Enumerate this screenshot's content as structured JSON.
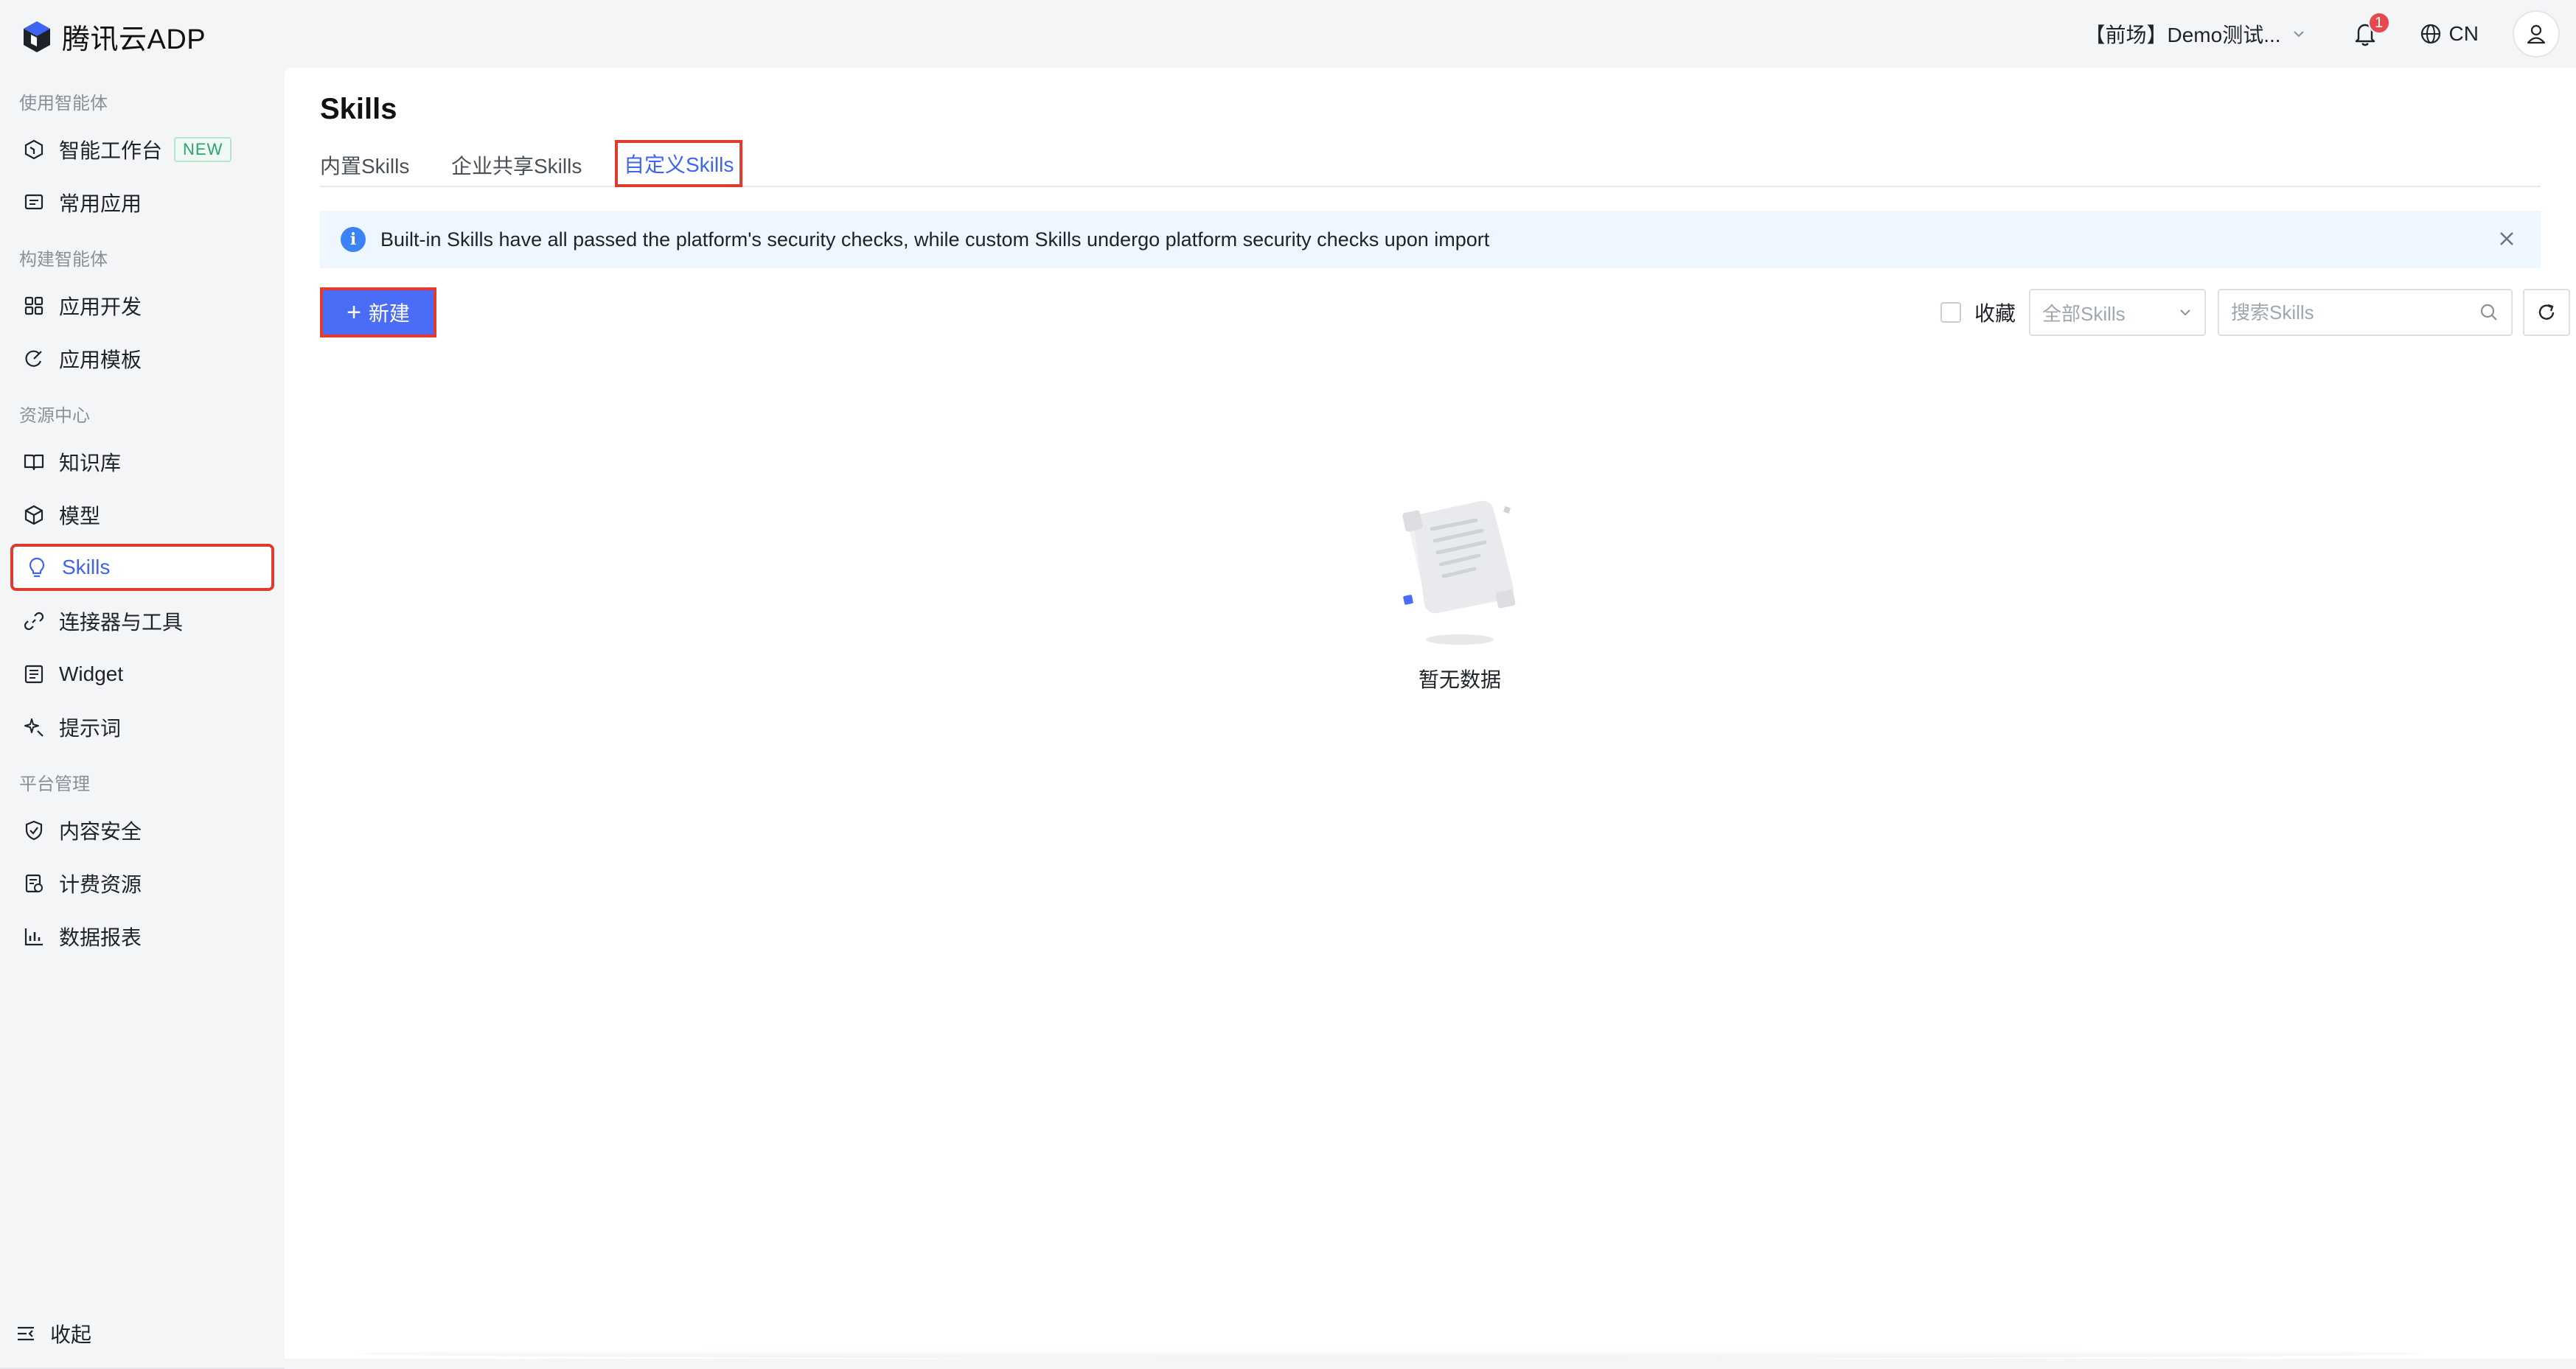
{
  "app": {
    "brand": "腾讯云ADP"
  },
  "header": {
    "project": "【前场】Demo测试...",
    "notification_count": "1",
    "language": "CN"
  },
  "sidebar": {
    "sections": [
      {
        "title": "使用智能体",
        "items": [
          {
            "label": "智能工作台",
            "tag": "NEW"
          },
          {
            "label": "常用应用"
          }
        ]
      },
      {
        "title": "构建智能体",
        "items": [
          {
            "label": "应用开发"
          },
          {
            "label": "应用模板"
          }
        ]
      },
      {
        "title": "资源中心",
        "items": [
          {
            "label": "知识库"
          },
          {
            "label": "模型"
          },
          {
            "label": "Skills"
          },
          {
            "label": "连接器与工具"
          },
          {
            "label": "Widget"
          },
          {
            "label": "提示词"
          }
        ]
      },
      {
        "title": "平台管理",
        "items": [
          {
            "label": "内容安全"
          },
          {
            "label": "计费资源"
          },
          {
            "label": "数据报表"
          }
        ]
      }
    ],
    "collapse_label": "收起"
  },
  "main": {
    "title": "Skills",
    "tabs": [
      {
        "label": "内置Skills"
      },
      {
        "label": "企业共享Skills"
      },
      {
        "label": "自定义Skills"
      }
    ],
    "alert": "Built-in Skills have all passed the platform's security checks, while custom Skills undergo platform security checks upon import",
    "new_button": "新建",
    "favorite_label": "收藏",
    "filter_select": "全部Skills",
    "search_placeholder": "搜索Skills",
    "empty_text": "暂无数据"
  },
  "colors": {
    "accent": "#3f63f3",
    "primary_button": "#4b6cf6",
    "highlight_border": "#e03b2e",
    "alert_bg": "#eef6ff"
  }
}
